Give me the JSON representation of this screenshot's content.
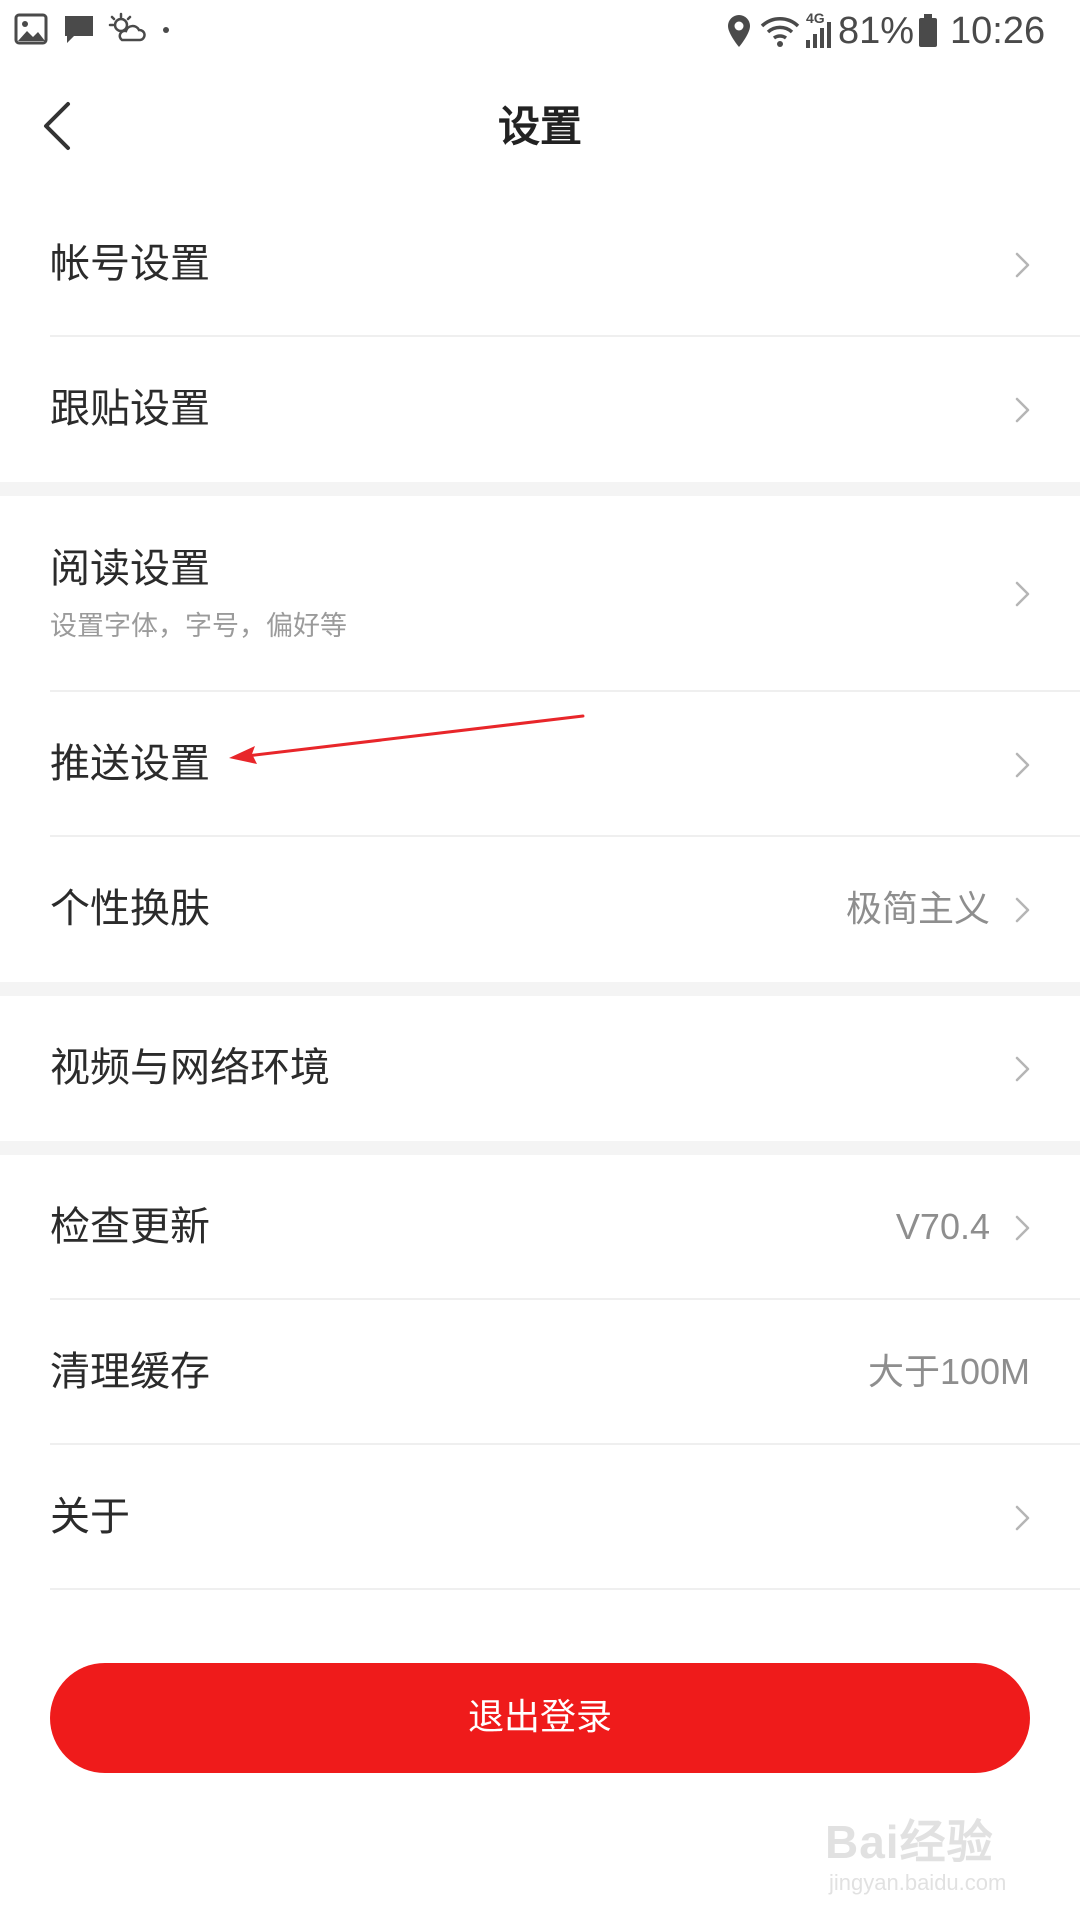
{
  "status_bar": {
    "battery": "81%",
    "time": "10:26",
    "network": "4G"
  },
  "nav": {
    "title": "设置"
  },
  "sections": [
    {
      "items": [
        {
          "label": "帐号设置"
        },
        {
          "label": "跟贴设置"
        }
      ]
    },
    {
      "items": [
        {
          "label": "阅读设置",
          "sublabel": "设置字体，字号，偏好等"
        },
        {
          "label": "推送设置"
        },
        {
          "label": "个性换肤",
          "value": "极简主义"
        }
      ]
    },
    {
      "items": [
        {
          "label": "视频与网络环境"
        }
      ]
    },
    {
      "items": [
        {
          "label": "检查更新",
          "value": "V70.4"
        },
        {
          "label": "清理缓存",
          "value": "大于100M"
        },
        {
          "label": "关于"
        }
      ]
    }
  ],
  "logout_label": "退出登录",
  "watermark": {
    "main": "Bai经验",
    "sub": "jingyan.baidu.com"
  },
  "colors": {
    "accent": "#ef1b1b",
    "annotation": "#e8262a"
  }
}
